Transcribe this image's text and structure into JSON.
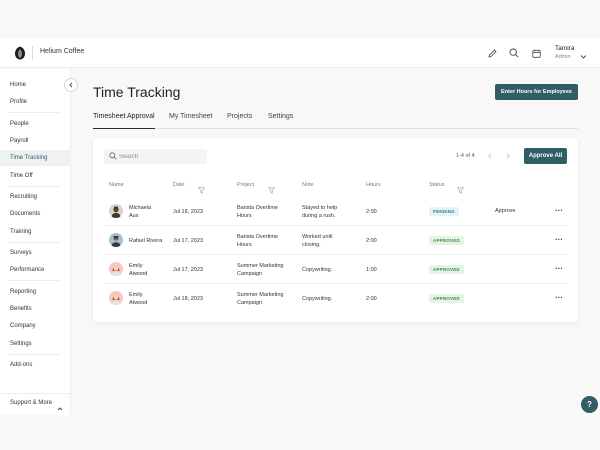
{
  "header": {
    "company": "Helium Coffee",
    "user_name": "Tamira",
    "user_role": "Admin",
    "icons": [
      "pencil-icon",
      "search-icon",
      "calendar-icon",
      "chevron-down-icon"
    ]
  },
  "sidebar": {
    "items": [
      {
        "label": "Home"
      },
      {
        "label": "Profile"
      },
      {
        "label": "People"
      },
      {
        "label": "Payroll"
      },
      {
        "label": "Time Tracking",
        "active": true
      },
      {
        "label": "Time Off"
      },
      {
        "label": "Recruiting"
      },
      {
        "label": "Documents"
      },
      {
        "label": "Training"
      },
      {
        "label": "Surveys"
      },
      {
        "label": "Performance"
      },
      {
        "label": "Reporting"
      },
      {
        "label": "Benefits"
      },
      {
        "label": "Company"
      },
      {
        "label": "Settings"
      },
      {
        "label": "Add-ons"
      }
    ],
    "support_label": "Support & More"
  },
  "main": {
    "title": "Time Tracking",
    "enter_hours_label": "Enter Hours for Employees",
    "tabs": [
      {
        "label": "Timesheet Approval",
        "active": true
      },
      {
        "label": "My Timesheet"
      },
      {
        "label": "Projects"
      },
      {
        "label": "Settings"
      }
    ],
    "search_placeholder": "Search",
    "pager": "1-4 of 4",
    "approve_all_label": "Approve All",
    "columns": [
      "Name",
      "Date",
      "Project",
      "Note",
      "Hours",
      "Status"
    ],
    "rows": [
      {
        "name_1": "Michaela",
        "name_2": "Aux",
        "date": "Jul 18, 2023",
        "project_1": "Barista Overtime",
        "project_2": "Hours",
        "note_1": "Stayed to help",
        "note_2": "during a rush.",
        "hours": "2:00",
        "status": "PENDING",
        "action": "Approve"
      },
      {
        "name_1": "Rafael Rivera",
        "name_2": "",
        "date": "Jul 17, 2023",
        "project_1": "Barista Overtime",
        "project_2": "Hours",
        "note_1": "Worked until",
        "note_2": "closing.",
        "hours": "2:00",
        "status": "APPROVED",
        "action": ""
      },
      {
        "name_1": "Emily",
        "name_2": "Atwood",
        "date": "Jul 17, 2023",
        "project_1": "Summer Marketing",
        "project_2": "Campaign",
        "note_1": "Copywriting.",
        "note_2": "",
        "hours": "1:00",
        "status": "APPROVED",
        "action": ""
      },
      {
        "name_1": "Emily",
        "name_2": "Atwood",
        "date": "Jul 18, 2023",
        "project_1": "Summer Marketing",
        "project_2": "Campaign",
        "note_1": "Copywriting.",
        "note_2": "",
        "hours": "2:00",
        "status": "APPROVED",
        "action": ""
      }
    ],
    "help_label": "?"
  },
  "colors": {
    "accent": "#2f5e65",
    "pending_bg": "#e3f3f6",
    "pending_text": "#2f7f8f",
    "approved_bg": "#e6f4e6",
    "approved_text": "#3f8a4a"
  }
}
